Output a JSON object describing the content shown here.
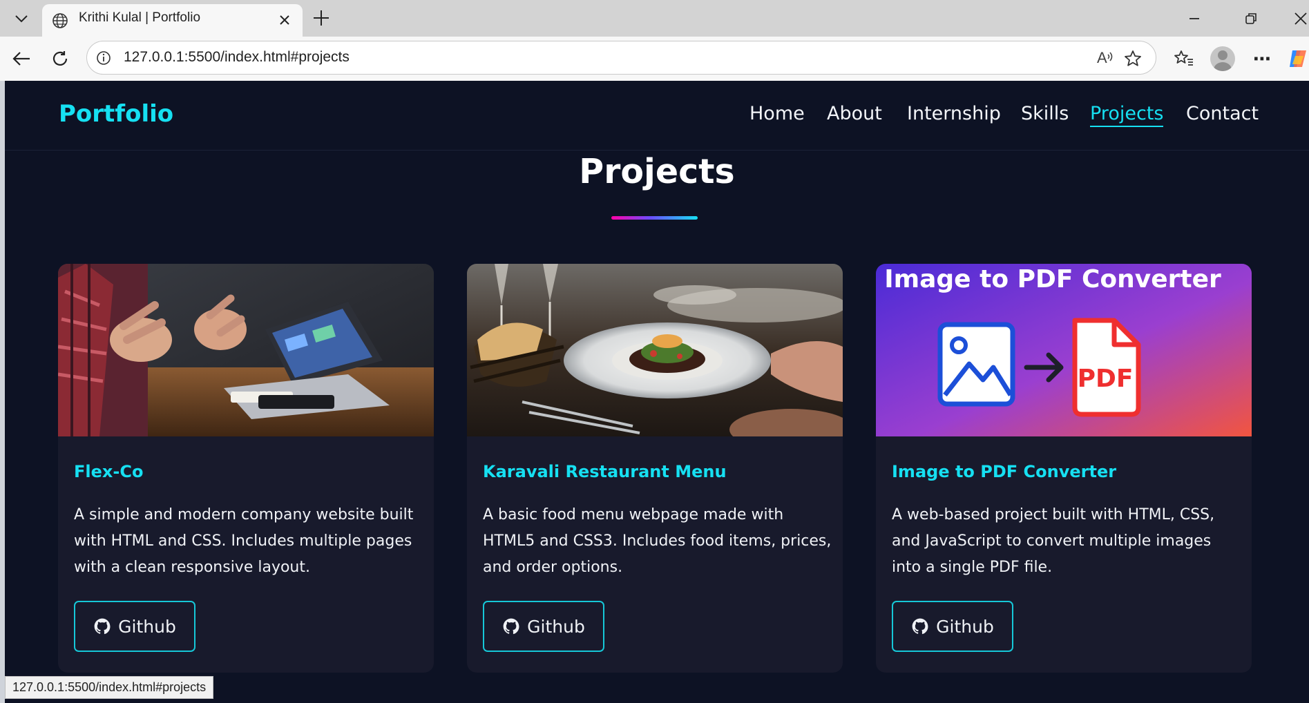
{
  "browser": {
    "tab_title": "Krithi Kulal | Portfolio",
    "url": "127.0.0.1:5500/index.html#projects",
    "status_url": "127.0.0.1:5500/index.html#projects",
    "read_aloud_label": "A",
    "more_label": "⋯"
  },
  "site": {
    "logo": "Portfolio",
    "nav": [
      {
        "label": "Home"
      },
      {
        "label": "About"
      },
      {
        "label": "Internship"
      },
      {
        "label": "Skills"
      },
      {
        "label": "Projects",
        "active": true
      },
      {
        "label": "Contact"
      }
    ]
  },
  "section": {
    "title": "Projects"
  },
  "projects": [
    {
      "title": "Flex-Co",
      "description": "A simple and modern company website built with HTML and CSS. Includes multiple pages with a clean responsive layout.",
      "button_label": "Github"
    },
    {
      "title": "Karavali Restaurant Menu",
      "description": "A basic food menu webpage made with HTML5 and CSS3. Includes food items, prices, and order options.",
      "button_label": "Github"
    },
    {
      "title": "Image to PDF Converter",
      "description": "A web-based project built with HTML, CSS, and JavaScript to convert multiple images into a single PDF file.",
      "button_label": "Github",
      "image_heading": "Image to PDF Converter",
      "image_badge": "PDF"
    }
  ],
  "colors": {
    "accent": "#16e0f2",
    "background": "#0d1224",
    "card": "#181a2c"
  },
  "icons": [
    "chevron-down-icon",
    "globe-icon",
    "close-icon",
    "plus-icon",
    "back-icon",
    "refresh-icon",
    "info-icon",
    "read-aloud-icon",
    "star-icon",
    "favorites-icon",
    "more-icon",
    "copilot-icon",
    "github-icon"
  ]
}
